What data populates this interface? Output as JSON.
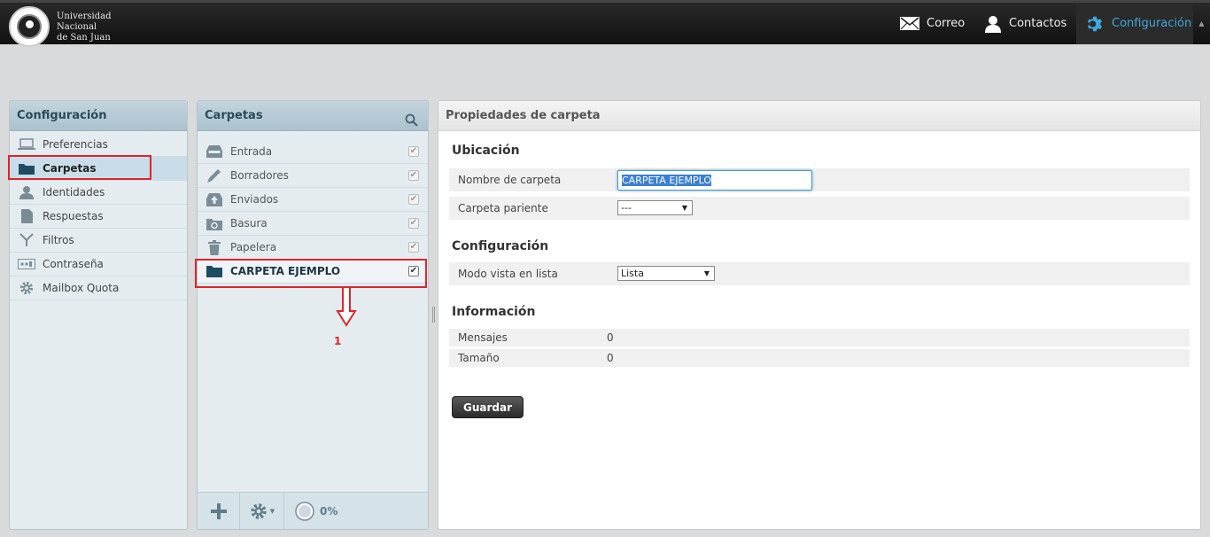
{
  "topbar": {
    "logo_name": "Universidad\nNacional\nde San Juan",
    "nav": {
      "mail": "Correo",
      "contacts": "Contactos",
      "settings": "Configuración"
    }
  },
  "settings_panel": {
    "title": "Configuración",
    "items": [
      {
        "label": "Preferencias",
        "icon": "laptop-icon"
      },
      {
        "label": "Carpetas",
        "icon": "folder-icon"
      },
      {
        "label": "Identidades",
        "icon": "person-icon"
      },
      {
        "label": "Respuestas",
        "icon": "document-icon"
      },
      {
        "label": "Filtros",
        "icon": "filter-icon"
      },
      {
        "label": "Contraseña",
        "icon": "password-icon"
      },
      {
        "label": "Mailbox Quota",
        "icon": "gear-icon"
      }
    ]
  },
  "folders_panel": {
    "title": "Carpetas",
    "items": [
      {
        "label": "Entrada",
        "icon": "inbox-icon"
      },
      {
        "label": "Borradores",
        "icon": "pencil-icon"
      },
      {
        "label": "Enviados",
        "icon": "sent-icon"
      },
      {
        "label": "Basura",
        "icon": "junk-icon"
      },
      {
        "label": "Papelera",
        "icon": "trash-icon"
      },
      {
        "label": "CARPETA EJEMPLO",
        "icon": "folder-icon"
      }
    ],
    "quota": "0%",
    "annotation": "1"
  },
  "props_panel": {
    "title": "Propiedades de carpeta",
    "sections": {
      "location": "Ubicación",
      "settings": "Configuración",
      "info": "Información"
    },
    "fields": {
      "folder_name_label": "Nombre de carpeta",
      "folder_name_value": "CARPETA EJEMPLO",
      "parent_label": "Carpeta pariente",
      "parent_value": "---",
      "view_mode_label": "Modo vista en lista",
      "view_mode_value": "Lista",
      "messages_label": "Mensajes",
      "messages_value": "0",
      "size_label": "Tamaño",
      "size_value": "0"
    },
    "save_label": "Guardar"
  }
}
